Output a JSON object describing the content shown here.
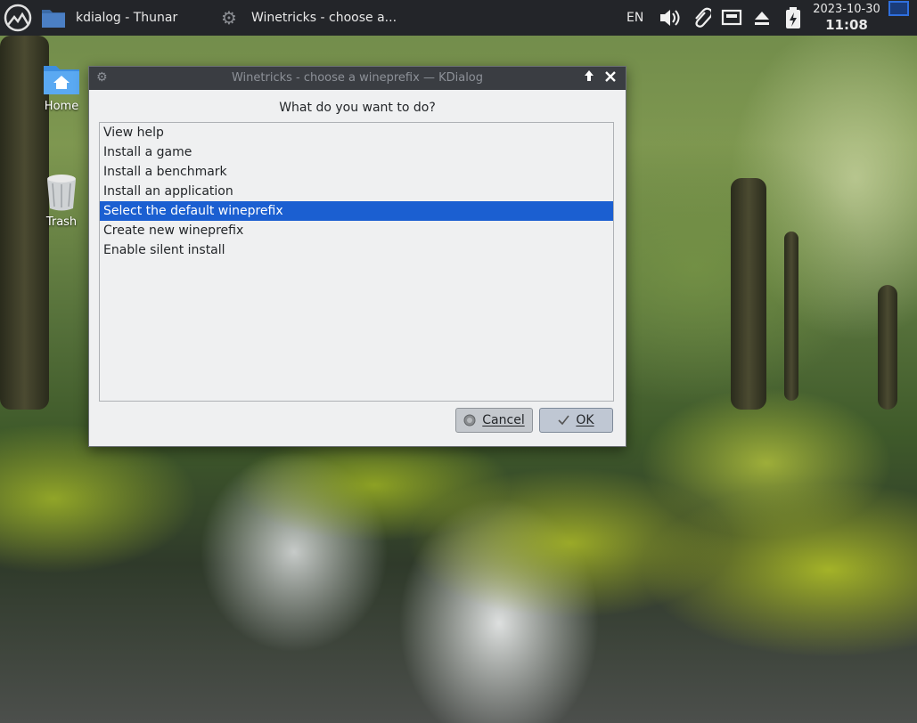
{
  "taskbar": {
    "tasks": [
      {
        "label": "kdialog - Thunar",
        "icon": "folder-icon"
      },
      {
        "label": "Winetricks - choose a...",
        "icon": "gear-icon"
      }
    ],
    "language": "EN",
    "date": "2023-10-30",
    "time": "11:08"
  },
  "desktop": {
    "icons": [
      {
        "label": "Home",
        "icon": "home-folder-icon"
      },
      {
        "label": "Trash",
        "icon": "trash-icon"
      }
    ]
  },
  "dialog": {
    "title": "Winetricks - choose a wineprefix — KDialog",
    "prompt": "What do you want to do?",
    "options": [
      "View help",
      "Install a game",
      "Install a benchmark",
      "Install an application",
      "Select the default wineprefix",
      "Create new wineprefix",
      "Enable silent install"
    ],
    "selected_index": 4,
    "cancel_label": "Cancel",
    "ok_label": "OK"
  },
  "colors": {
    "selection": "#1b5fd1",
    "taskbar": "#232529",
    "titlebar": "#3a3d42"
  }
}
